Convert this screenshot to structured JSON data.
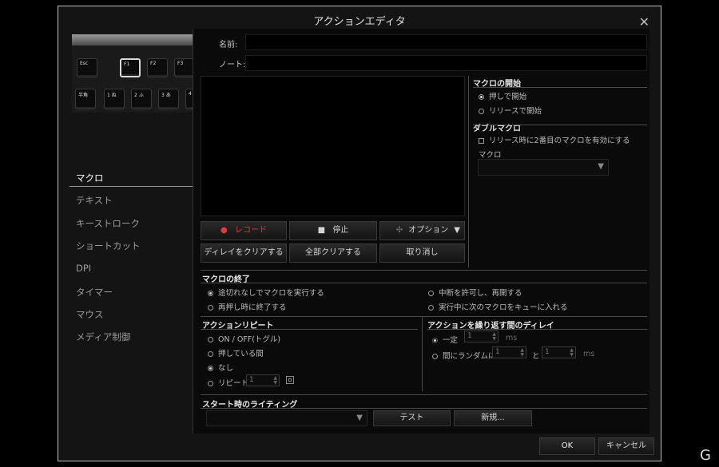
{
  "window": {
    "title": "アクションエディタ"
  },
  "keyboard": {
    "keys": [
      {
        "label": "Esc",
        "selected": false
      },
      {
        "label": "F1",
        "selected": true
      },
      {
        "label": "F2",
        "selected": false
      },
      {
        "label": "F3",
        "selected": false
      },
      {
        "label": "半角",
        "selected": false
      },
      {
        "label": "1 ぬ",
        "selected": false
      },
      {
        "label": "2 ふ",
        "selected": false
      },
      {
        "label": "3 あ",
        "selected": false
      },
      {
        "label": "4",
        "selected": false
      }
    ]
  },
  "sidebar": {
    "items": [
      {
        "label": "マクロ",
        "active": true
      },
      {
        "label": "テキスト",
        "active": false
      },
      {
        "label": "キーストローク",
        "active": false
      },
      {
        "label": "ショートカット",
        "active": false
      },
      {
        "label": "DPI",
        "active": false
      },
      {
        "label": "タイマー",
        "active": false
      },
      {
        "label": "マウス",
        "active": false
      },
      {
        "label": "メディア制御",
        "active": false
      }
    ]
  },
  "form": {
    "name_label": "名前:",
    "name_value": "",
    "note_label": "ノート:",
    "note_value": ""
  },
  "record_buttons": {
    "record": "レコード",
    "stop": "停止",
    "options": "オプション",
    "clear_delay": "ディレイをクリアする",
    "clear_all": "全部クリアする",
    "undo": "取り消し"
  },
  "macro_start": {
    "title": "マクロの開始",
    "options": [
      {
        "label": "押しで開始",
        "selected": true
      },
      {
        "label": "リリースで開始",
        "selected": false
      }
    ]
  },
  "double_macro": {
    "title": "ダブルマクロ",
    "checkbox_label": "リリース時に2番目のマクロを有効にする",
    "checked": false,
    "macro_label": "マクロ",
    "macro_value": ""
  },
  "macro_end": {
    "title": "マクロの終了",
    "options": [
      {
        "label": "途切れなしでマクロを実行する",
        "selected": true
      },
      {
        "label": "再押し時に終了する",
        "selected": false
      },
      {
        "label": "中断を許可し、再開する",
        "selected": false
      },
      {
        "label": "実行中に次のマクロをキューに入れる",
        "selected": false
      }
    ]
  },
  "action_repeat": {
    "title": "アクションリピート",
    "options": [
      {
        "label": "ON / OFF(トグル)",
        "selected": false
      },
      {
        "label": "押している間",
        "selected": false
      },
      {
        "label": "なし",
        "selected": true
      },
      {
        "label": "リピート",
        "selected": false
      }
    ],
    "repeat_count": "1"
  },
  "repeat_delay": {
    "title": "アクションを繰り返す間のディレイ",
    "fixed_label": "一定",
    "fixed_value": "1",
    "fixed_unit": "ms",
    "random_label": "間にランダムに",
    "random_min": "1",
    "random_and": "と",
    "random_max": "1",
    "random_unit": "ms"
  },
  "lighting": {
    "title": "スタート時のライティング",
    "value": "",
    "test": "テスト",
    "new": "新規..."
  },
  "footer": {
    "ok": "OK",
    "cancel": "キャンセル"
  },
  "watermark": "G"
}
